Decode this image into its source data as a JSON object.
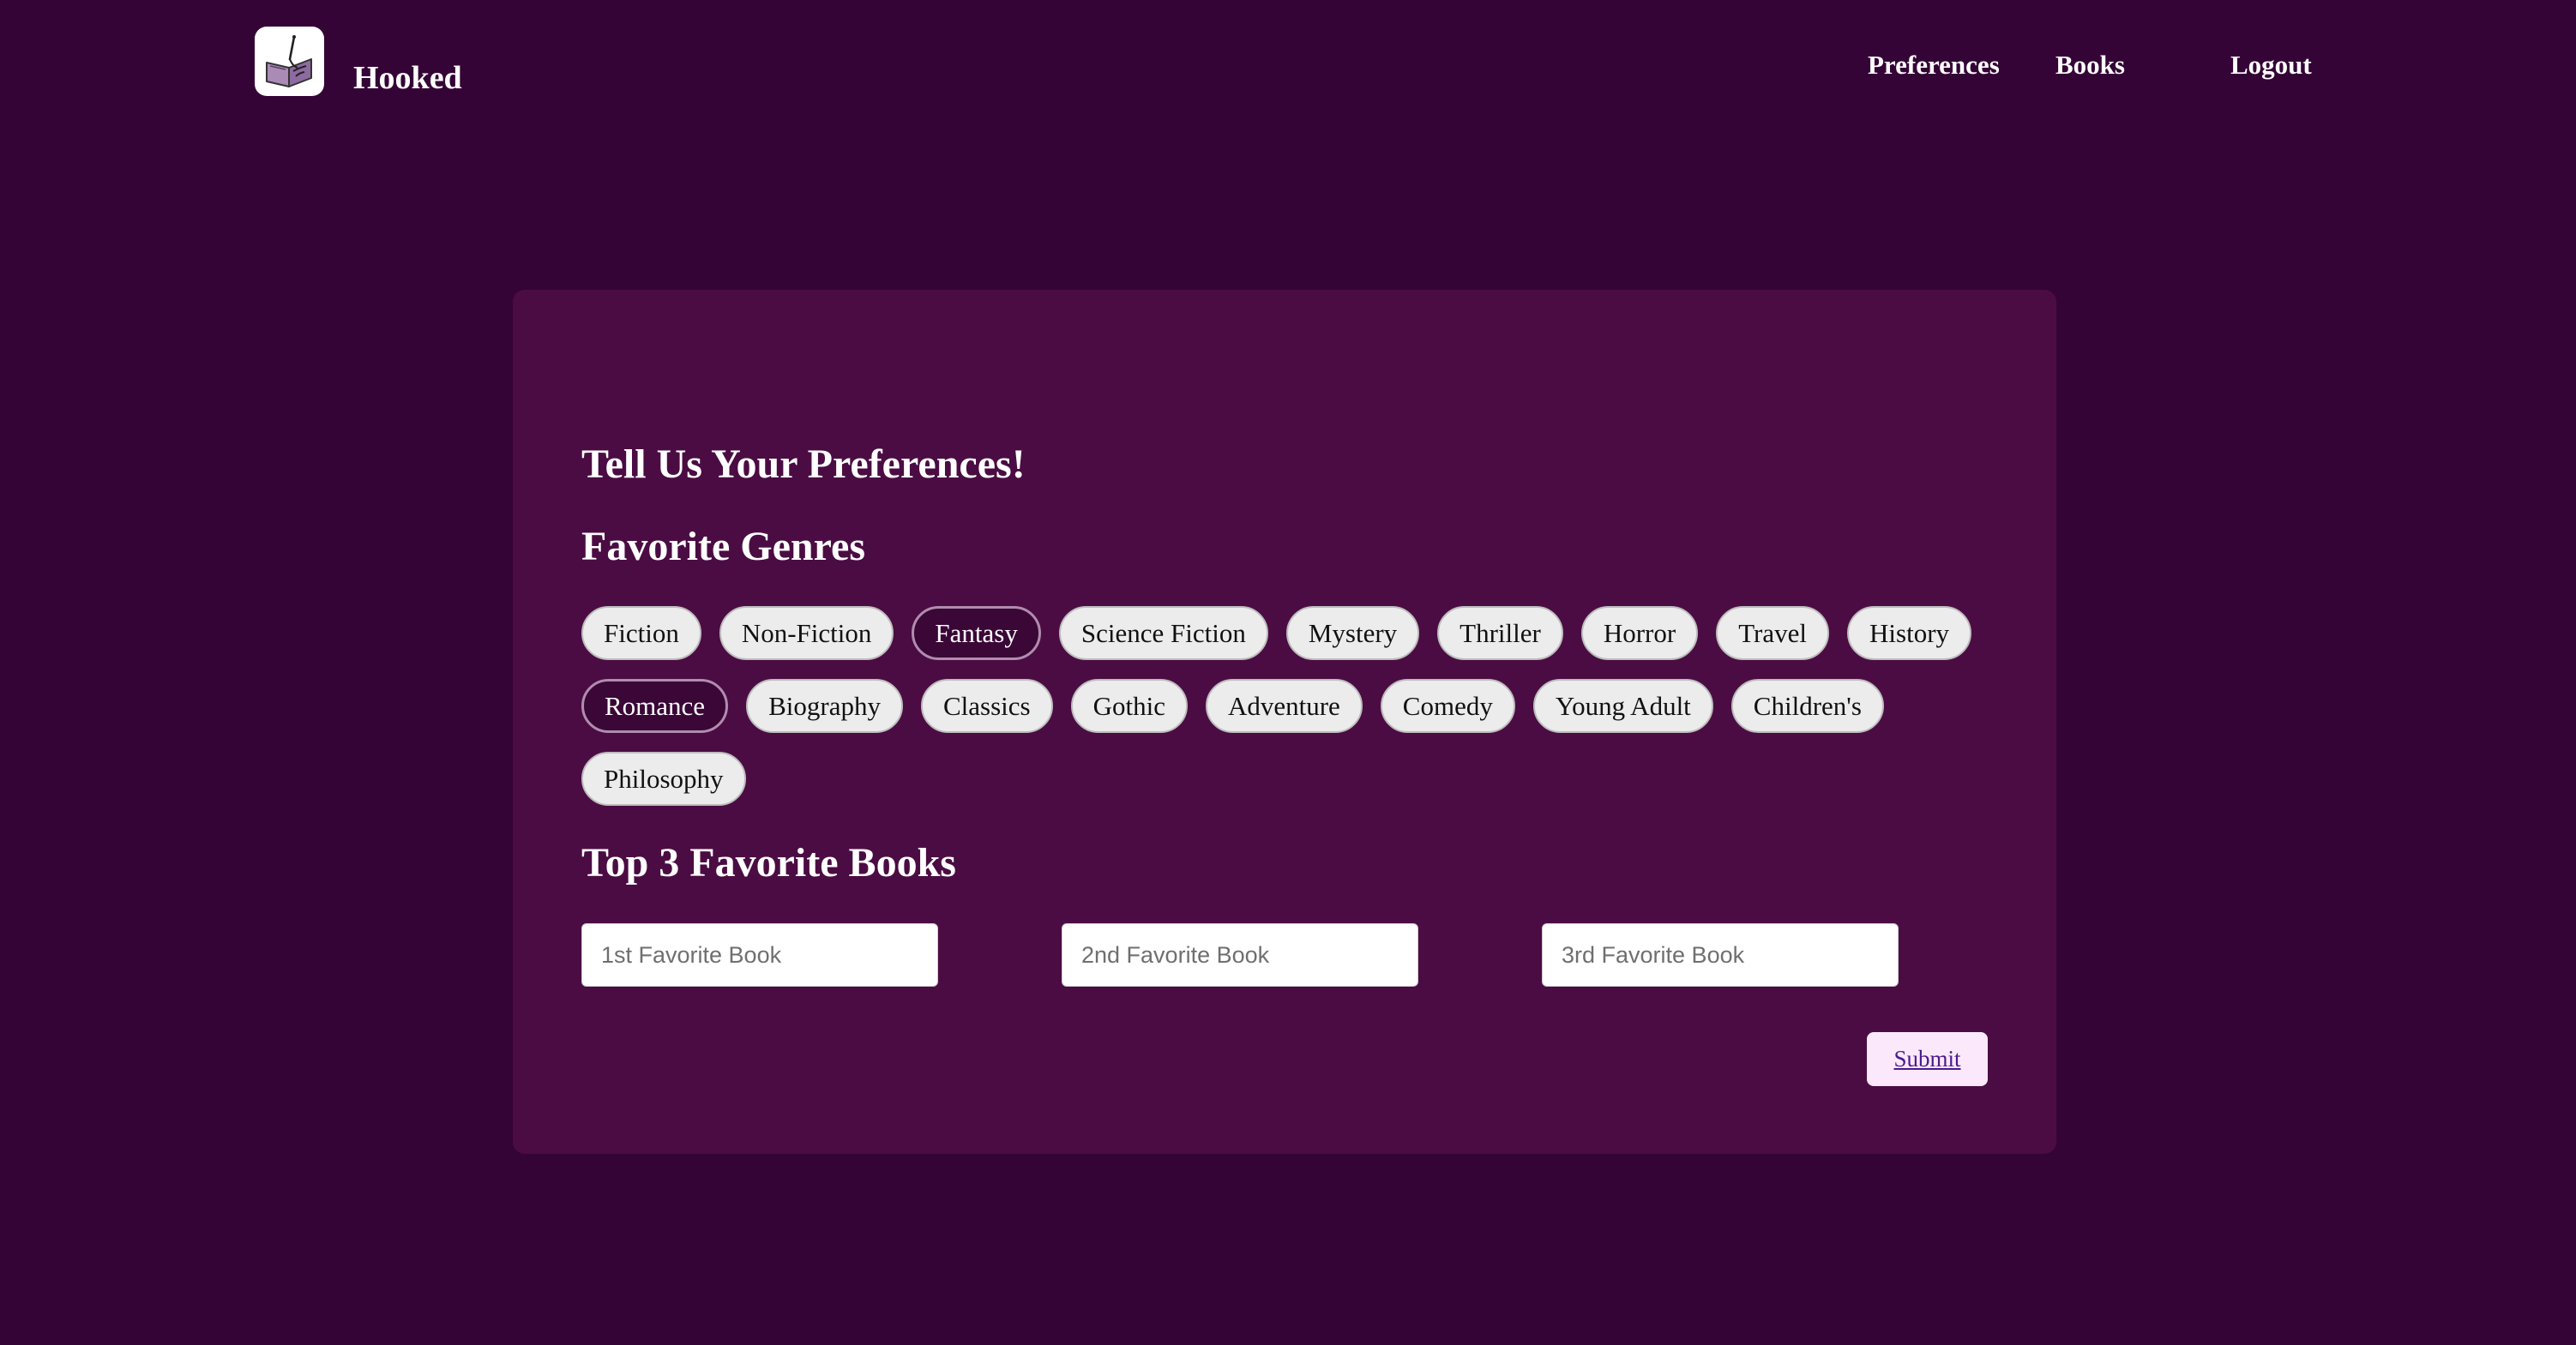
{
  "app": {
    "name": "Hooked",
    "logo_icon": "book-hook-logo-icon"
  },
  "nav": {
    "items": [
      "Preferences",
      "Books",
      "Logout"
    ]
  },
  "colors": {
    "background": "#350436",
    "card": "#4b0c43",
    "pill": "#ececec",
    "pill_selected": "#3a0737",
    "submit_bg": "#fbe9fb",
    "submit_text": "#4b1a8c"
  },
  "main": {
    "title": "Tell Us Your Preferences!",
    "genres_heading": "Favorite Genres",
    "genres": [
      {
        "label": "Fiction",
        "selected": false
      },
      {
        "label": "Non-Fiction",
        "selected": false
      },
      {
        "label": "Fantasy",
        "selected": true
      },
      {
        "label": "Science Fiction",
        "selected": false
      },
      {
        "label": "Mystery",
        "selected": false
      },
      {
        "label": "Thriller",
        "selected": false
      },
      {
        "label": "Horror",
        "selected": false
      },
      {
        "label": "Travel",
        "selected": false
      },
      {
        "label": "History",
        "selected": false
      },
      {
        "label": "Romance",
        "selected": true
      },
      {
        "label": "Biography",
        "selected": false
      },
      {
        "label": "Classics",
        "selected": false
      },
      {
        "label": "Gothic",
        "selected": false
      },
      {
        "label": "Adventure",
        "selected": false
      },
      {
        "label": "Comedy",
        "selected": false
      },
      {
        "label": "Young Adult",
        "selected": false
      },
      {
        "label": "Children's",
        "selected": false
      },
      {
        "label": "Philosophy",
        "selected": false
      }
    ],
    "books_heading": "Top 3 Favorite Books",
    "book_inputs": [
      {
        "placeholder": "1st Favorite Book",
        "value": ""
      },
      {
        "placeholder": "2nd Favorite Book",
        "value": ""
      },
      {
        "placeholder": "3rd Favorite Book",
        "value": ""
      }
    ],
    "submit_label": "Submit"
  }
}
